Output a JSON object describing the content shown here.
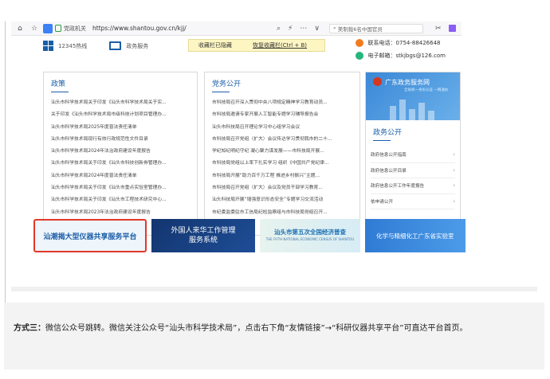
{
  "browser": {
    "site_badge": "党政机关",
    "url": "https://www.shantou.gov.cn/kjj/",
    "search_placeholder": "美制裁6名中国官员",
    "controls": [
      "⌕",
      "⚡",
      "⋯",
      "∨"
    ],
    "right_controls": [
      "✂"
    ]
  },
  "services": {
    "item1": "12345热线",
    "item2": "政务服务"
  },
  "tooltip": {
    "text1": "收藏栏已隐藏",
    "text2": "恢复收藏栏(Ctrl + B)"
  },
  "contact": {
    "phone": "联系电话：0754-88426648",
    "email": "电子邮箱：stkjbgs@126.com"
  },
  "panel_policy": {
    "title": "政策",
    "items": [
      "汕头市科学技术局关于印发《汕头市科学技术局关于实...",
      "关于印发《汕头市科学技术局市级科技计划项目管理办...",
      "汕头市科学技术局2025年度普法责任清单",
      "汕头市科学技术局现行有效行政规范性文件目录",
      "汕头市科学技术局2024年法治政府建设年度报告",
      "汕头市科学技术局关于印发《汕头市科技创新券管理办...",
      "汕头市科学技术局2024年度普法责任清单",
      "汕头市科学技术局关于印发《汕头市重点实验室管理办...",
      "汕头市科学技术局关于印发《汕头市工程技术研究中心...",
      "汕头市科学技术局2023年法治政府建设年度报告"
    ]
  },
  "panel_affairs": {
    "title": "党务公开",
    "items": [
      "市科技局召开深入贯彻中央八项规定精神学习教育动员...",
      "市科技局邀请专家开展人工智能专题学习辅导报告会",
      "汕头市科技局召开理论学习中心组学习会议",
      "市科技局召开党组（扩大）会议传达学习贯彻我市的二十...",
      "学纪知纪明纪守纪 凝心聚力谋发展——市科技局开展...",
      "市科技局党组以上率下扎实学习 组织《中国共产党纪律...",
      "市科技局开展“助力百千万工程 推进乡村振兴”主题...",
      "市科技局召开党组（扩大）会议及党员干部学习教育...",
      "汕头科技局开展“增强意识形态安全”专题学习交流活动",
      "市纪委监委驻市工信局纪检监察组与市科技局党组召开..."
    ]
  },
  "panel_gov": {
    "banner_title": "广东政务服务网",
    "banner_sub": "全省统一身份认证 一网通办",
    "title": "政务公开",
    "items": [
      "政府信息公开指南",
      "政府信息公开目录",
      "政府信息公开工作年度报告",
      "依申请公开"
    ]
  },
  "banners": {
    "b1": "汕潮揭大型仪器共享服务平台",
    "b2_line1": "外国人来华工作管理",
    "b2_line2": "服务系统",
    "b3_line1": "汕头市第五次全国经济普查",
    "b3_sub": "THE FIFTH NATIONAL ECONOMIC CENSUS OF SHANTOU",
    "b4": "化学与精细化工广东省实验室"
  },
  "caption": {
    "lead": "方式三：",
    "text": "微信公众号跳转。微信关注公众号“汕头市科学技术局”，点击右下角“友情链接”→“科研仪器共享平台”可直达平台首页。"
  }
}
